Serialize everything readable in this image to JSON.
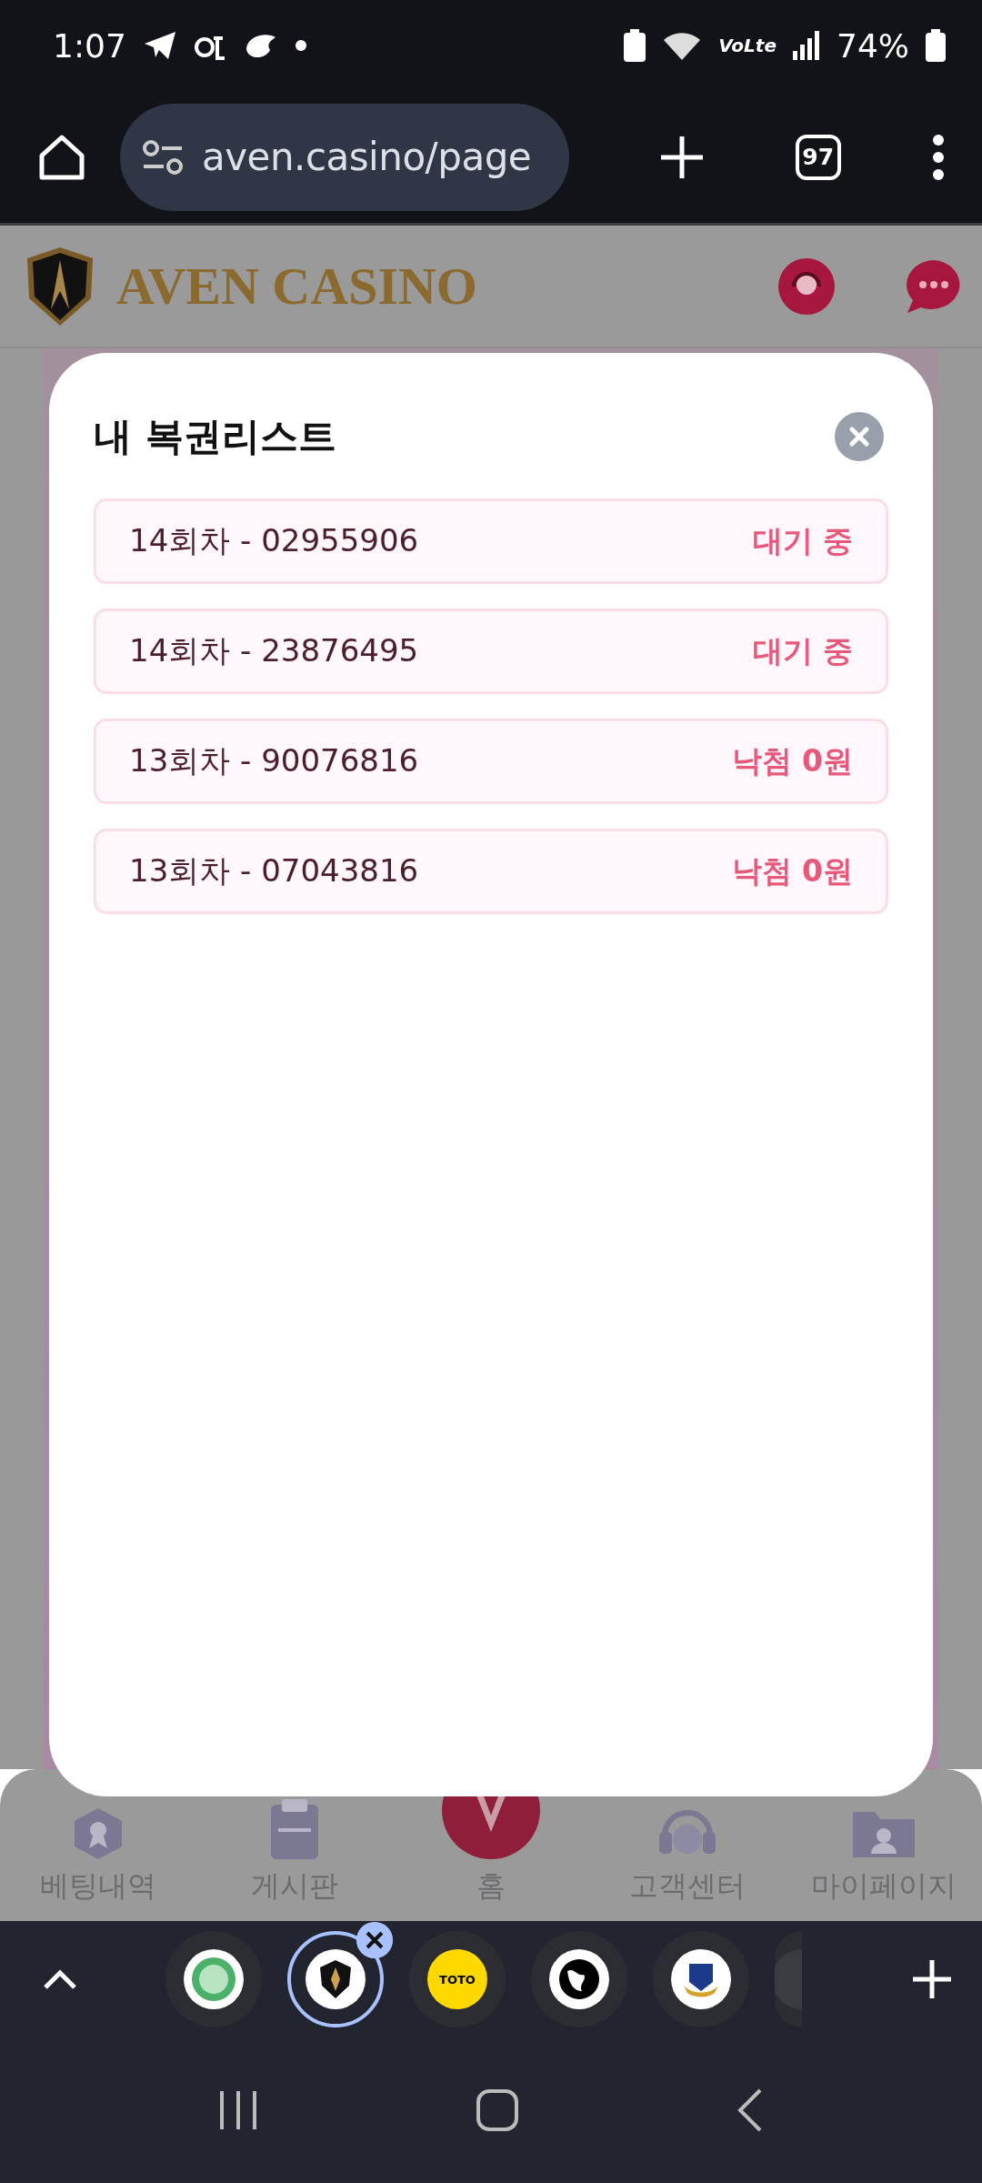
{
  "status_bar": {
    "time": "1:07",
    "network": "VoLte",
    "battery": "74%"
  },
  "browser": {
    "url": "aven.casino/page",
    "tab_count": "97"
  },
  "site_header": {
    "brand": "AVEN CASINO"
  },
  "modal": {
    "title": "내 복권리스트",
    "tickets": [
      {
        "name": "14회차 - 02955906",
        "status": "대기 중"
      },
      {
        "name": "14회차 - 23876495",
        "status": "대기 중"
      },
      {
        "name": "13회차 - 90076816",
        "status": "낙첨 0원"
      },
      {
        "name": "13회차 - 07043816",
        "status": "낙첨 0원"
      }
    ]
  },
  "bottom_nav": [
    {
      "label": "베팅내역",
      "kind": "ribbon"
    },
    {
      "label": "게시판",
      "kind": "board"
    },
    {
      "label": "홈",
      "kind": "home"
    },
    {
      "label": "고객센터",
      "kind": "headset"
    },
    {
      "label": "마이페이지",
      "kind": "profile"
    }
  ],
  "tab_strip": [
    {
      "selected": false,
      "kind": "green"
    },
    {
      "selected": true,
      "kind": "shield"
    },
    {
      "selected": false,
      "kind": "talk",
      "label": "TOTO"
    },
    {
      "selected": false,
      "kind": "globe"
    },
    {
      "selected": false,
      "kind": "crest"
    },
    {
      "selected": false,
      "kind": "partial"
    }
  ]
}
